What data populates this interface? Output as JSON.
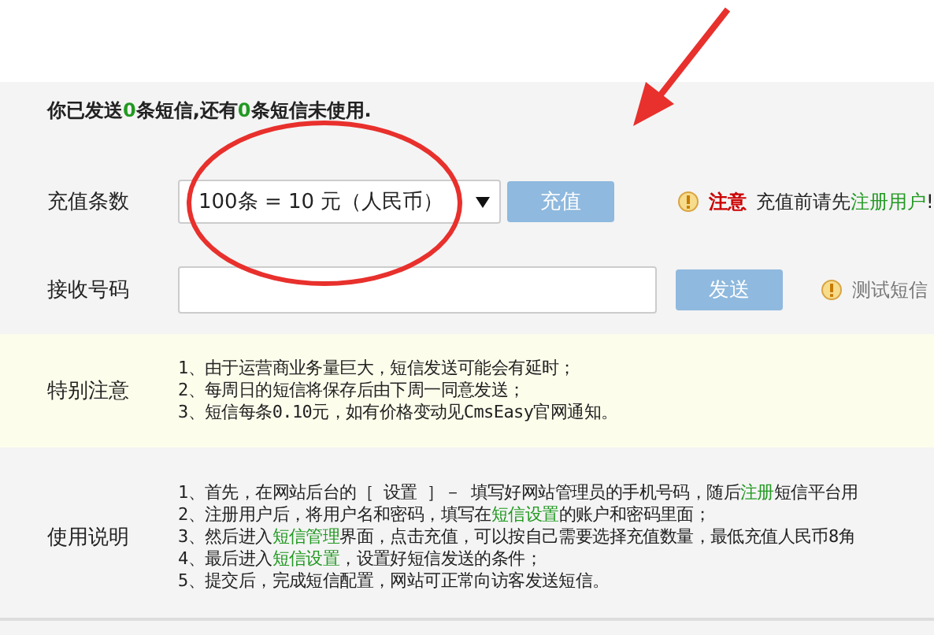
{
  "summary": [
    {
      "text": "你已发送",
      "kind": "plain"
    },
    {
      "text": "0",
      "kind": "link"
    },
    {
      "text": "条短信,还有",
      "kind": "plain"
    },
    {
      "text": "0",
      "kind": "link"
    },
    {
      "text": "条短信未使用.",
      "kind": "plain"
    }
  ],
  "recharge": {
    "label": "充值条数",
    "select_value": "100条 = 10 元（人民币）",
    "button": "充值",
    "notice_title": "注意",
    "notice": [
      {
        "text": "充值前请先",
        "kind": "plain"
      },
      {
        "text": "注册用户",
        "kind": "link"
      },
      {
        "text": "!",
        "kind": "plain"
      }
    ]
  },
  "receiver": {
    "label": "接收号码",
    "button": "发送",
    "hint": "测试短信"
  },
  "special_notes": {
    "label": "特别注意",
    "lines": [
      "1、由于运营商业务量巨大，短信发送可能会有延时；",
      "2、每周日的短信将保存后由下周一同意发送；",
      "3、短信每条0.10元，如有价格变动见CmsEasy官网通知。"
    ]
  },
  "usage": {
    "label": "使用说明",
    "lines": [
      [
        {
          "text": "1、首先，在网站后台的［ 设置 ］－ 填写好网站管理员的手机号码，随后",
          "kind": "plain"
        },
        {
          "text": "注册",
          "kind": "link"
        },
        {
          "text": "短信平台用",
          "kind": "plain"
        }
      ],
      [
        {
          "text": "2、注册用户后，将用户名和密码，填写在",
          "kind": "plain"
        },
        {
          "text": "短信设置",
          "kind": "link"
        },
        {
          "text": "的账户和密码里面；",
          "kind": "plain"
        }
      ],
      [
        {
          "text": "3、然后进入",
          "kind": "plain"
        },
        {
          "text": "短信管理",
          "kind": "link"
        },
        {
          "text": "界面，点击充值，可以按自己需要选择充值数量，最低充值人民币8角",
          "kind": "plain"
        }
      ],
      [
        {
          "text": "4、最后进入",
          "kind": "plain"
        },
        {
          "text": "短信设置",
          "kind": "link"
        },
        {
          "text": "，设置好短信发送的条件；",
          "kind": "plain"
        }
      ],
      [
        {
          "text": "5、提交后，完成短信配置，网站可正常向访客发送短信。",
          "kind": "plain"
        }
      ]
    ]
  },
  "annotations": {
    "circle": true,
    "arrow": true
  }
}
